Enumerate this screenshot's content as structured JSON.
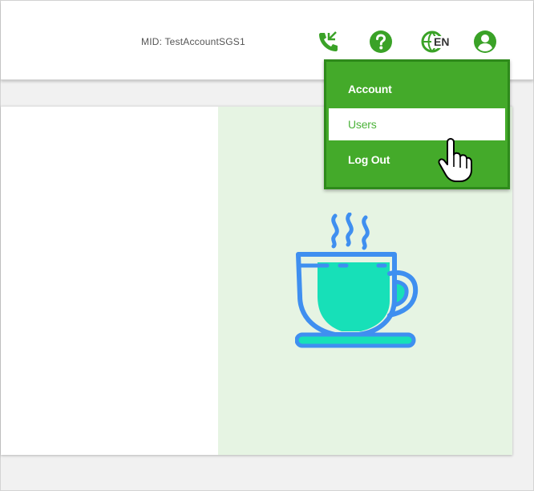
{
  "header": {
    "mid_label": "MID: TestAccountSGS1",
    "icons": [
      "phone-icon",
      "help-icon",
      "language-icon",
      "user-account-icon"
    ],
    "language_code": "EN",
    "icon_color": "#3aa227"
  },
  "user_menu": {
    "items": [
      {
        "label": "Account",
        "active": false
      },
      {
        "label": "Users",
        "active": true
      },
      {
        "label": "Log Out",
        "active": false
      }
    ],
    "background_color": "#44aa2a",
    "active_text_color": "#4cb33a"
  },
  "content": {
    "illustration": "coffee-cup-icon",
    "panel_color": "#e6f4e3"
  }
}
